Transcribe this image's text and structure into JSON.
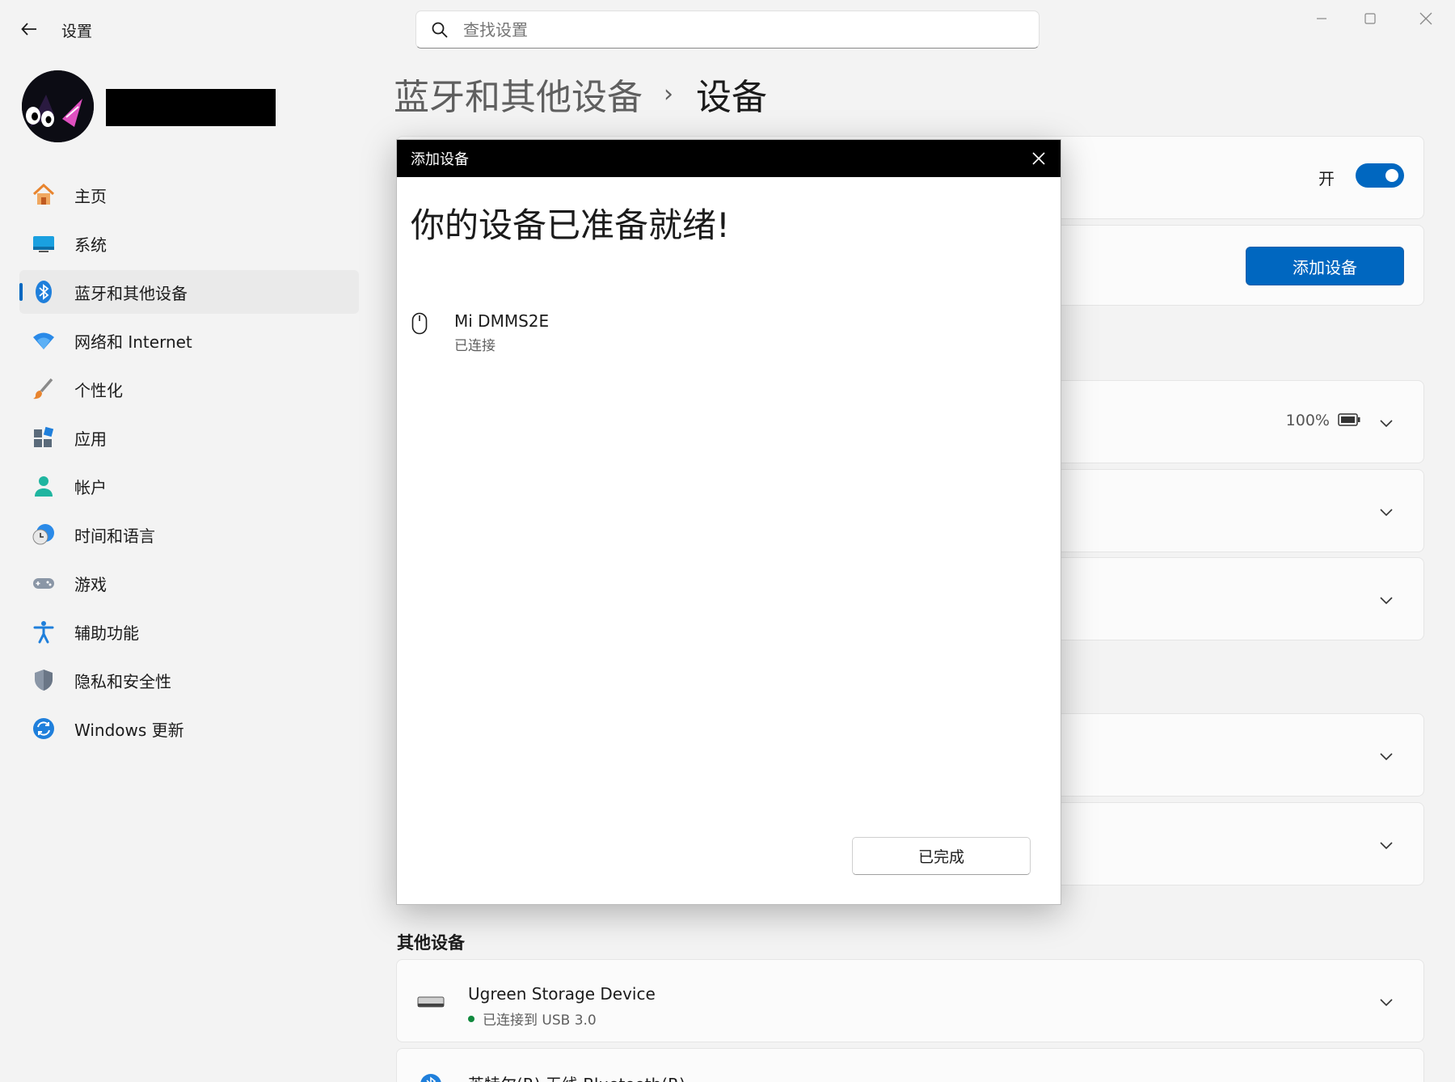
{
  "window": {
    "title": "设置"
  },
  "search": {
    "placeholder": "查找设置"
  },
  "sidebar": {
    "items": [
      {
        "label": "主页",
        "icon": "home-icon"
      },
      {
        "label": "系统",
        "icon": "system-icon"
      },
      {
        "label": "蓝牙和其他设备",
        "icon": "bluetooth-icon",
        "active": true
      },
      {
        "label": "网络和 Internet",
        "icon": "wifi-icon"
      },
      {
        "label": "个性化",
        "icon": "brush-icon"
      },
      {
        "label": "应用",
        "icon": "apps-icon"
      },
      {
        "label": "帐户",
        "icon": "account-icon"
      },
      {
        "label": "时间和语言",
        "icon": "time-language-icon"
      },
      {
        "label": "游戏",
        "icon": "gamepad-icon"
      },
      {
        "label": "辅助功能",
        "icon": "accessibility-icon"
      },
      {
        "label": "隐私和安全性",
        "icon": "shield-icon"
      },
      {
        "label": "Windows 更新",
        "icon": "update-icon"
      }
    ]
  },
  "breadcrumb": {
    "parent": "蓝牙和其他设备",
    "separator": "›",
    "current": "设备"
  },
  "background": {
    "toggle_label": "开",
    "add_device_label": "添加设备",
    "battery_text": "100%",
    "other_devices_title": "其他设备",
    "devices": [
      {
        "name": "Ugreen Storage Device",
        "status": "已连接到 USB 3.0"
      },
      {
        "name": "英特尔(R) 无线 Bluetooth(R)"
      }
    ]
  },
  "dialog": {
    "title": "添加设备",
    "heading": "你的设备已准备就绪!",
    "device_name": "Mi DMMS2E",
    "device_status": "已连接",
    "done_label": "已完成"
  },
  "colors": {
    "accent": "#0067c0",
    "background": "#f3f3f3",
    "dialog_titlebar": "#000000",
    "status_green": "#10893e"
  }
}
